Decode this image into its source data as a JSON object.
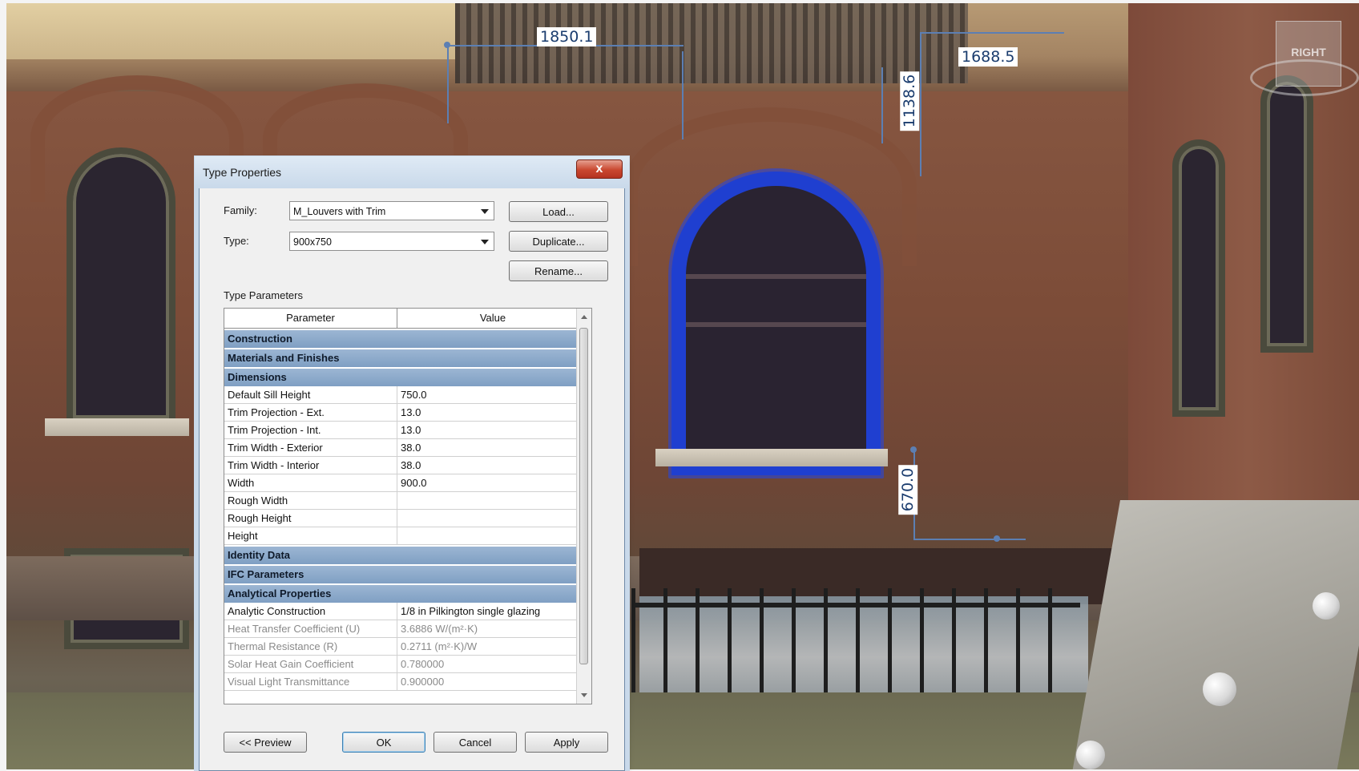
{
  "viewport": {
    "dimensions": [
      "1850.1",
      "1688.5",
      "1138.6",
      "670.0"
    ],
    "viewcube_label": "RIGHT"
  },
  "dialog": {
    "title": "Type Properties",
    "close_label": "x",
    "family_label": "Family:",
    "family_value": "M_Louvers with Trim",
    "type_label": "Type:",
    "type_value": "900x750",
    "load_label": "Load...",
    "duplicate_label": "Duplicate...",
    "rename_label": "Rename...",
    "type_parameters_label": "Type Parameters",
    "columns": {
      "parameter": "Parameter",
      "value": "Value"
    },
    "groups": {
      "construction": "Construction",
      "materials": "Materials and Finishes",
      "dimensions": "Dimensions",
      "identity": "Identity Data",
      "ifc": "IFC Parameters",
      "analytical": "Analytical Properties"
    },
    "chevrons": {
      "collapsed": "»",
      "expanded": "«"
    },
    "dimension_rows": [
      {
        "p": "Default Sill Height",
        "v": "750.0"
      },
      {
        "p": "Trim Projection - Ext.",
        "v": "13.0"
      },
      {
        "p": "Trim Projection - Int.",
        "v": "13.0"
      },
      {
        "p": "Trim Width - Exterior",
        "v": "38.0"
      },
      {
        "p": "Trim Width - Interior",
        "v": "38.0"
      },
      {
        "p": "Width",
        "v": "900.0"
      },
      {
        "p": "Rough Width",
        "v": ""
      },
      {
        "p": "Rough Height",
        "v": ""
      },
      {
        "p": "Height",
        "v": ""
      }
    ],
    "analytical_rows": [
      {
        "p": "Analytic Construction",
        "v": "1/8 in Pilkington single glazing"
      },
      {
        "p": "Heat Transfer Coefficient (U)",
        "v": "3.6886 W/(m²·K)"
      },
      {
        "p": "Thermal Resistance (R)",
        "v": "0.2711 (m²·K)/W"
      },
      {
        "p": "Solar Heat Gain Coefficient",
        "v": "0.780000"
      },
      {
        "p": "Visual Light Transmittance",
        "v": "0.900000"
      }
    ],
    "buttons": {
      "preview": "<< Preview",
      "ok": "OK",
      "cancel": "Cancel",
      "apply": "Apply"
    }
  },
  "colors": {
    "selection": "#1f3fd0",
    "dimension": "#1a3c6e",
    "group_header": "#8aa8cb"
  }
}
